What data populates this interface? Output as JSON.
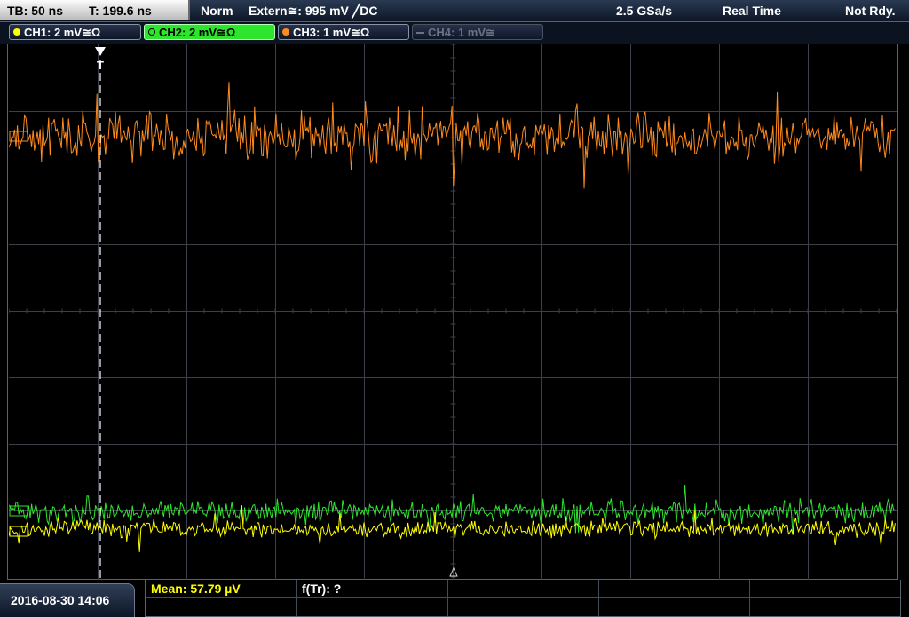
{
  "status": {
    "timebase": "TB: 50 ns",
    "trigger_time": "T: 199.6 ns",
    "trigger_mode": "Norm",
    "trigger_source": "Extern≅: 995 mV ╱DC",
    "sample_rate": "2.5 GSa/s",
    "acq_mode": "Real Time",
    "trigger_status": "Not Rdy."
  },
  "channels": [
    {
      "label": "CH1: 2 mV≅Ω",
      "color": "#ffff00",
      "state": "on"
    },
    {
      "label": "CH2: 2 mV≅Ω",
      "color": "#2ee52e",
      "state": "active"
    },
    {
      "label": "CH3: 1 mV≅Ω",
      "color": "#ff8a1e",
      "state": "on"
    },
    {
      "label": "CH4: 1 mV≅",
      "color": "#6c7280",
      "state": "off"
    }
  ],
  "trigger_marker": "T",
  "datetime": "2016-08-30  14:06",
  "measurements": {
    "mean": "Mean: 57.79 µV",
    "ftr": "f(Tr): ?"
  },
  "colors": {
    "ch1": "#ffff00",
    "ch2": "#2ee52e",
    "ch3": "#ff8a1e",
    "grid": "#3a3f48",
    "meas_text": "#ffff00"
  }
}
